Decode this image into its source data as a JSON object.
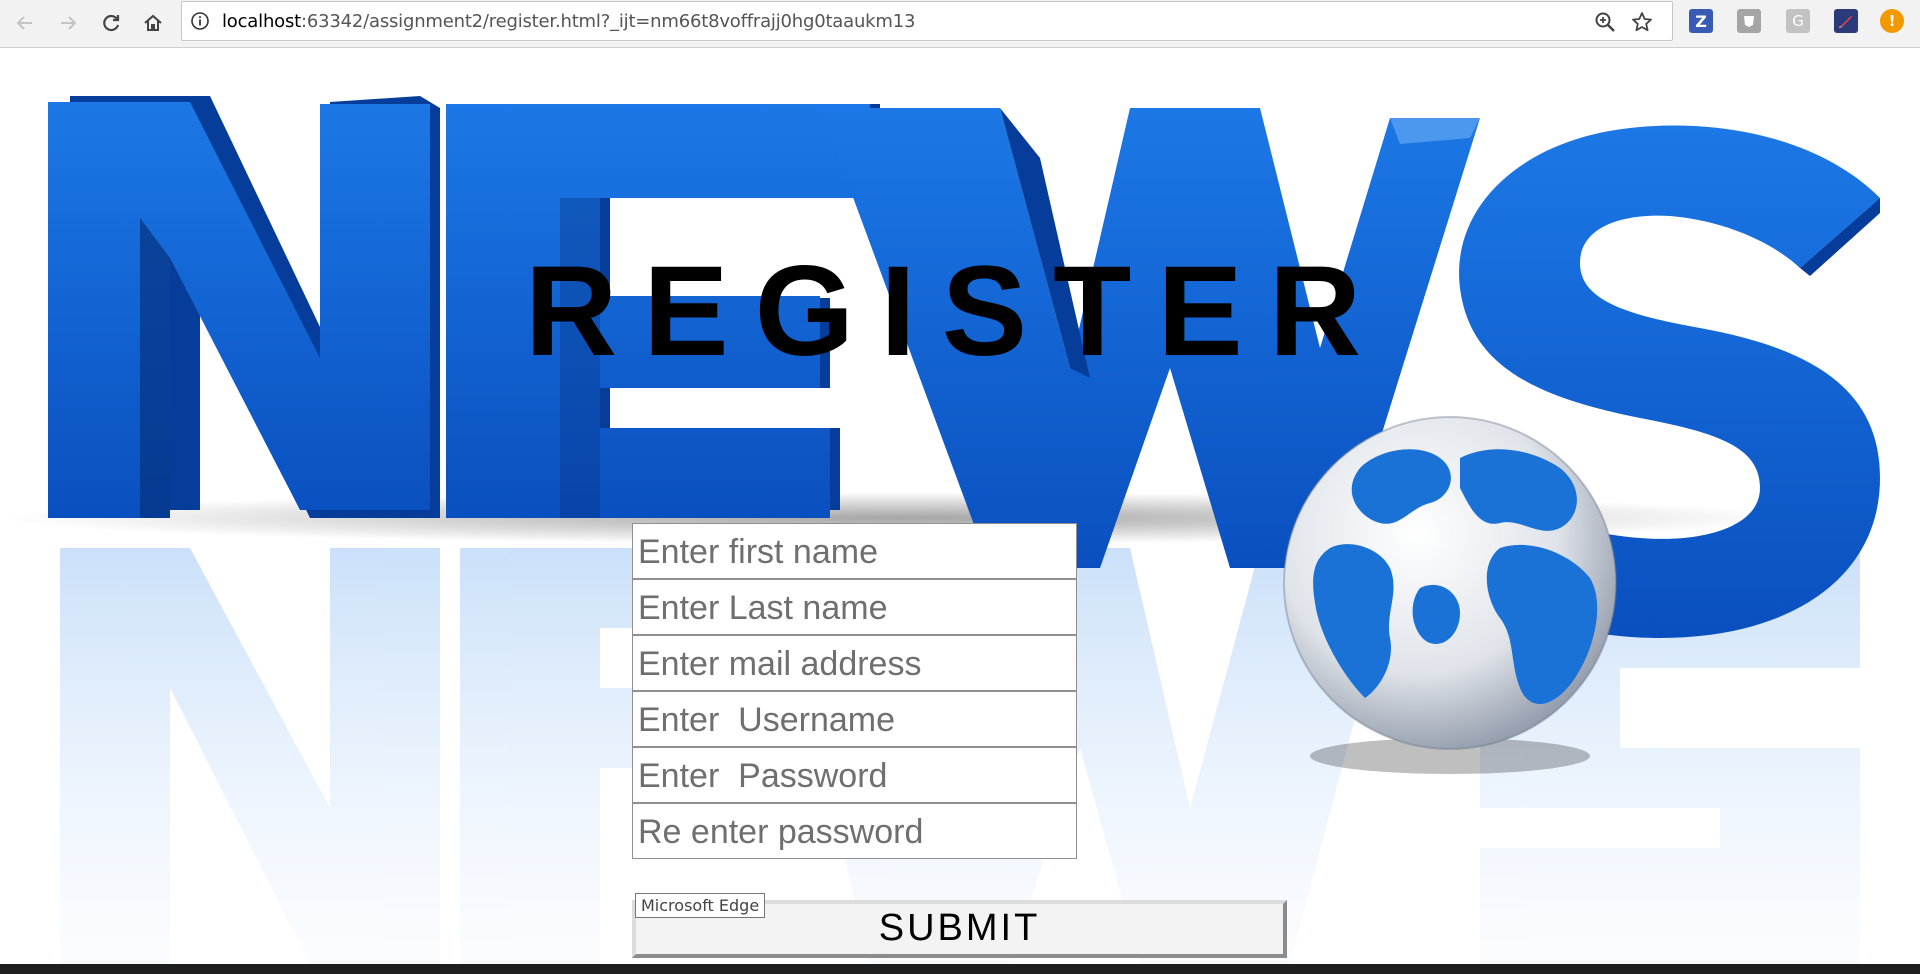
{
  "browser": {
    "url_host": "localhost",
    "url_rest": ":63342/assignment2/register.html?_ijt=nm66t8voffrajj0hg0taaukm13",
    "tooltip": "Microsoft Edge",
    "extensions": [
      {
        "name": "z-extension-icon",
        "glyph": "Z",
        "color": "#3a5bb3"
      },
      {
        "name": "shield-extension-icon",
        "glyph": "",
        "color": "#9c9c9c"
      },
      {
        "name": "g-extension-icon",
        "glyph": "G",
        "color": "#bdbdbd"
      },
      {
        "name": "pen-extension-icon",
        "glyph": "",
        "color": "#2b3a7a"
      },
      {
        "name": "alert-extension-icon",
        "glyph": "!",
        "color": "#f29900"
      }
    ]
  },
  "page": {
    "title": "REGISTER",
    "background": "news-globe-image",
    "accent_blue": "#0b63d8"
  },
  "form": {
    "first_name_placeholder": "Enter first name",
    "last_name_placeholder": "Enter Last name",
    "email_placeholder": "Enter mail address",
    "username_placeholder": "Enter  Username",
    "password_placeholder": "Enter  Password",
    "repassword_placeholder": "Re enter password",
    "submit_label": "SUBMIT"
  }
}
